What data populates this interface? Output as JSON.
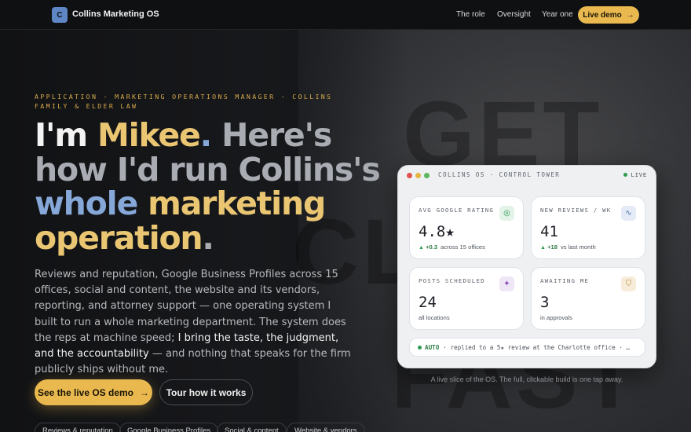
{
  "nav": {
    "logo_letter": "C",
    "brand": "Collins Marketing OS",
    "links": [
      "The role",
      "Oversight",
      "Year one"
    ],
    "cta": "Live demo",
    "cta_icon": "arrow-right-icon"
  },
  "background": {
    "words": [
      "GET",
      "CL",
      "FAST"
    ]
  },
  "hero": {
    "eyebrow": "Application · Marketing Operations Manager · Collins Family & Elder Law",
    "headline": {
      "w1": "I'm ",
      "w2": "Mikee",
      "w3": ".",
      "w4": " Here's how I'd run Collins's ",
      "w5": "whole",
      "w6": " marketing operation",
      "w7": "."
    },
    "body": "Reviews and reputation, Google Business Profiles across 15 offices, social and content, the website and its vendors, reporting, and attorney support — one operating system I built to run a whole marketing department. The system does the reps at machine speed; ",
    "body_strong": "I bring the taste, the judgment, and the accountability",
    "body_end": " — and nothing that speaks for the firm publicly ships without me.",
    "primary_cta": "See the live OS demo",
    "secondary_cta": "Tour how it works",
    "chips": [
      "Reviews & reputation",
      "Google Business Profiles",
      "Social & content",
      "Website & vendors"
    ]
  },
  "dashboard": {
    "title": "COLLINS OS · CONTROL TOWER",
    "live": "LIVE",
    "tiles": [
      {
        "label": "AVG GOOGLE RATING",
        "value": "4.8★",
        "delta": "+0.3",
        "sub": "across 15 offices",
        "icon": "target-icon"
      },
      {
        "label": "NEW REVIEWS / WK",
        "value": "41",
        "delta": "+18",
        "sub": "vs last month",
        "icon": "pulse-icon"
      },
      {
        "label": "POSTS SCHEDULED",
        "value": "24",
        "delta": "",
        "sub": "all locations",
        "icon": "sparkle-icon"
      },
      {
        "label": "AWAITING ME",
        "value": "3",
        "delta": "",
        "sub": "in approvals",
        "icon": "shield-icon"
      }
    ],
    "ticker_tag": "AUTO",
    "ticker_text": "· replied to a 5★ review at the Charlotte office · …"
  },
  "caption": "A live slice of the OS. The full, clickable build is one tap away.",
  "colors": {
    "accent": "#e9b94f",
    "blue": "#86a8d8",
    "success": "#2e9b52"
  }
}
